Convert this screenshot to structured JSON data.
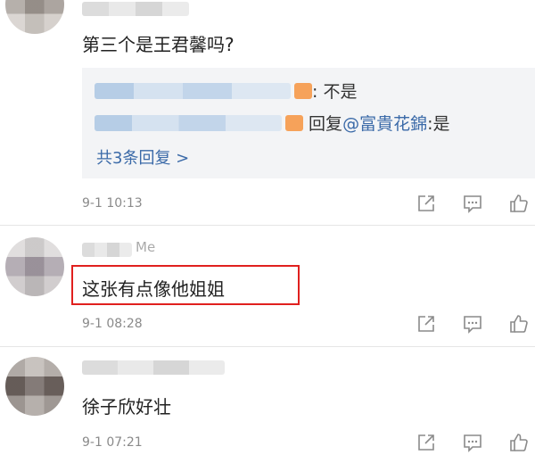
{
  "comments": [
    {
      "text": "第三个是王君馨吗?",
      "replies": [
        {
          "text": ": 不是"
        },
        {
          "reply_word": "回复",
          "mention": "@富貴花錦",
          "text": ":是"
        }
      ],
      "more_replies": "共3条回复 >",
      "time": "9-1 10:13"
    },
    {
      "name_partial": "Me",
      "text": "这张有点像他姐姐",
      "time": "9-1 08:28"
    },
    {
      "text": "徐子欣好壮",
      "time": "9-1 07:21"
    }
  ],
  "colors": {
    "link": "#3b6aa8",
    "highlight_border": "#e0201e",
    "meta_gray": "#8a8a8a",
    "reply_bg": "#f3f4f6"
  },
  "icons": [
    "share-icon",
    "comment-icon",
    "like-icon"
  ]
}
